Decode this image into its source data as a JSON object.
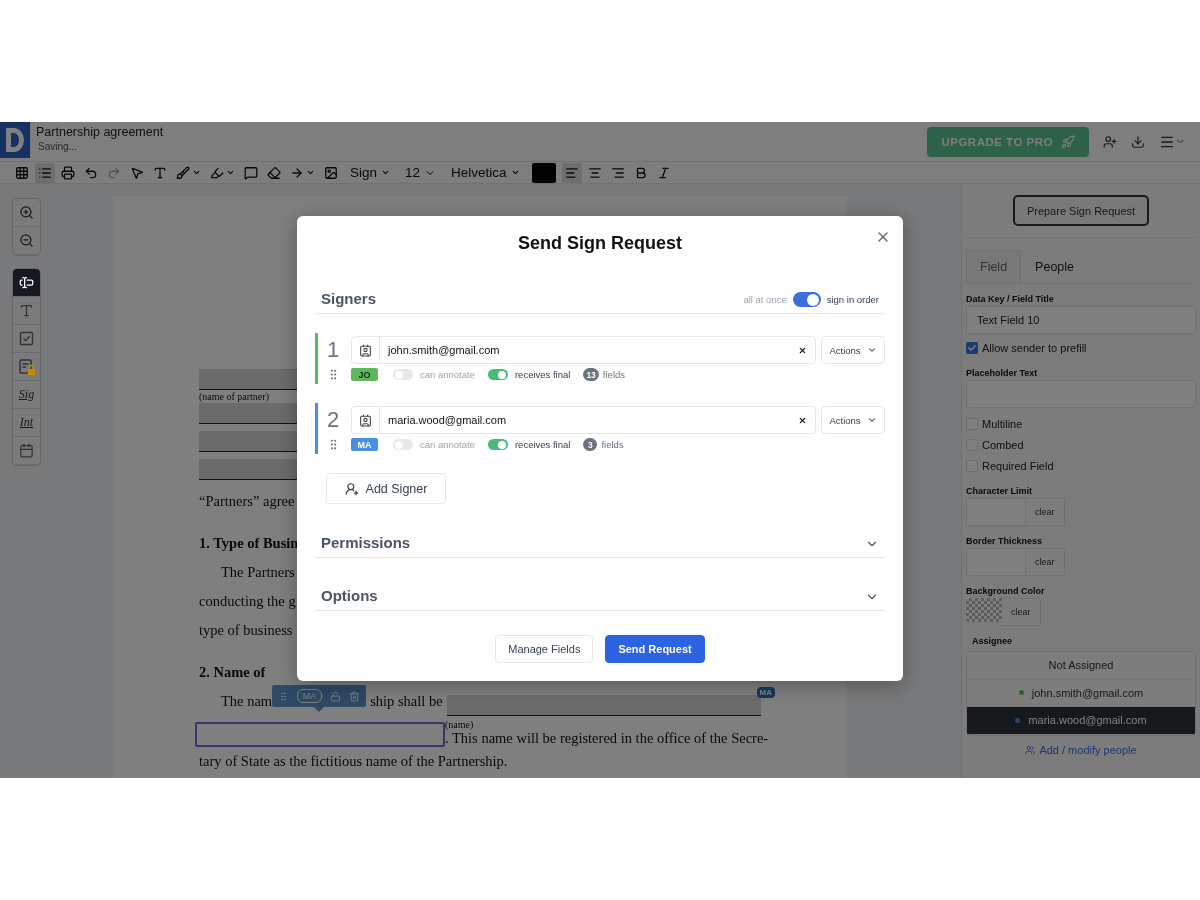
{
  "header": {
    "title": "Partnership agreement",
    "status": "Saving...",
    "upgrade": "UPGRADE TO PRO"
  },
  "toolbar": [
    {
      "kind": "icon",
      "selected": false,
      "disabled": false,
      "caret": false
    },
    {
      "kind": "icon",
      "selected": true,
      "disabled": false,
      "caret": false
    },
    {
      "kind": "icon",
      "selected": false,
      "disabled": false,
      "caret": false
    },
    {
      "kind": "icon",
      "selected": false,
      "disabled": false,
      "caret": false
    },
    {
      "kind": "icon",
      "selected": false,
      "disabled": true,
      "caret": false
    },
    {
      "kind": "icon",
      "selected": false,
      "disabled": false,
      "caret": false
    },
    {
      "kind": "icon",
      "selected": false,
      "disabled": false,
      "caret": false
    },
    {
      "kind": "icon",
      "selected": false,
      "disabled": false,
      "caret": true
    },
    {
      "kind": "icon",
      "selected": false,
      "disabled": false,
      "caret": true
    },
    {
      "kind": "icon",
      "selected": false,
      "disabled": false,
      "caret": false
    },
    {
      "kind": "icon",
      "selected": false,
      "disabled": false,
      "caret": false
    },
    {
      "kind": "icon",
      "selected": false,
      "disabled": false,
      "caret": true
    },
    {
      "kind": "icon",
      "selected": false,
      "disabled": false,
      "caret": false
    },
    {
      "kind": "menu",
      "label": "Sign"
    },
    {
      "kind": "select",
      "label": "12"
    },
    {
      "kind": "menu",
      "label": "Helvetica"
    },
    {
      "kind": "swatch",
      "color": "#000000"
    },
    {
      "kind": "icon",
      "selected": true,
      "disabled": false,
      "caret": false
    },
    {
      "kind": "icon",
      "selected": false,
      "disabled": false,
      "caret": false
    },
    {
      "kind": "icon",
      "selected": false,
      "disabled": false,
      "caret": false
    },
    {
      "kind": "icon",
      "selected": false,
      "disabled": false,
      "caret": false
    },
    {
      "kind": "icon",
      "selected": false,
      "disabled": false,
      "caret": false
    }
  ],
  "tools": [
    {
      "kind": "icon",
      "selected": true
    },
    {
      "kind": "icon",
      "selected": false
    },
    {
      "kind": "icon",
      "selected": false
    },
    {
      "kind": "icon",
      "selected": false
    },
    {
      "kind": "script",
      "label": "Sig",
      "selected": false
    },
    {
      "kind": "script",
      "label": "Int",
      "selected": false
    },
    {
      "kind": "icon",
      "selected": false
    }
  ],
  "document": {
    "lines": [
      {
        "kind": "blank"
      },
      {
        "kind": "caption",
        "text": "(name of partner)"
      },
      {
        "kind": "blank"
      },
      {
        "kind": "blank"
      },
      {
        "kind": "blank"
      },
      {
        "kind": "text",
        "text": "“Partners” agree"
      },
      {
        "kind": "heading",
        "text": "1. Type of Busin"
      },
      {
        "kind": "indent",
        "text": "The Partners"
      },
      {
        "kind": "text",
        "text": "conducting the g"
      },
      {
        "kind": "text",
        "text": "type of business"
      },
      {
        "kind": "heading",
        "text": "2. Name of"
      },
      {
        "kind": "name-line",
        "before": "The nam",
        "after": "ship shall be",
        "tag": "MA"
      },
      {
        "kind": "field-line",
        "caption": "(name)",
        "text": ". This name will be registered in the office of the Secre-"
      },
      {
        "kind": "text",
        "text": "tary of State as the fictitious name of the Partnership."
      }
    ],
    "field_toolbar": {
      "tag": "MA"
    }
  },
  "panel": {
    "prepare_button": "Prepare Sign Request",
    "tabs": [
      {
        "label": "Field",
        "selected": true
      },
      {
        "label": "People",
        "selected": false
      }
    ],
    "data_key": {
      "label": "Data Key / Field Title",
      "value": "Text Field 10"
    },
    "prefill": {
      "label": "Allow sender to prefill",
      "checked": true
    },
    "placeholder_text": {
      "label": "Placeholder Text"
    },
    "options": [
      {
        "label": "Multiline",
        "checked": false
      },
      {
        "label": "Combed",
        "checked": false
      },
      {
        "label": "Required Field",
        "checked": false
      }
    ],
    "char_limit": {
      "label": "Character Limit",
      "button": "clear"
    },
    "border_thickness": {
      "label": "Border Thickness",
      "button": "clear"
    },
    "background": {
      "label": "Background Color",
      "button": "clear"
    },
    "assignee": {
      "label": "Assignee",
      "items": [
        {
          "label": "Not Assigned",
          "selected": false
        },
        {
          "label": "john.smith@gmail.com",
          "selected": false,
          "color": "#2e5c2e"
        },
        {
          "label": "maria.wood@gmail.com",
          "selected": true,
          "color": "#254871"
        }
      ]
    },
    "link": "Add / modify people"
  },
  "modal": {
    "title": "Send Sign Request",
    "signers_title": "Signers",
    "order": {
      "off_label": "all at once",
      "on_label": "sign in order",
      "on": true
    },
    "signers": [
      {
        "number": "1",
        "email": "john.smith@gmail.com",
        "actions": "Actions",
        "initials": "JO",
        "color": "#5cb85c",
        "annotate": {
          "label": "can annotate",
          "on": false
        },
        "final": {
          "label": "receives final",
          "on": true
        },
        "count": "13",
        "count_label": "fields"
      },
      {
        "number": "2",
        "email": "maria.wood@gmail.com",
        "actions": "Actions",
        "initials": "MA",
        "color": "#4a90e2",
        "annotate": {
          "label": "can annotate",
          "on": false
        },
        "final": {
          "label": "receives final",
          "on": true
        },
        "count": "3",
        "count_label": "fields"
      }
    ],
    "add_signer": "Add Signer",
    "sections": [
      {
        "label": "Permissions",
        "expanded": false
      },
      {
        "label": "Options",
        "expanded": false
      }
    ],
    "buttons": [
      {
        "kind": "secondary",
        "label": "Manage Fields"
      },
      {
        "kind": "primary",
        "label": "Send Request"
      }
    ]
  }
}
